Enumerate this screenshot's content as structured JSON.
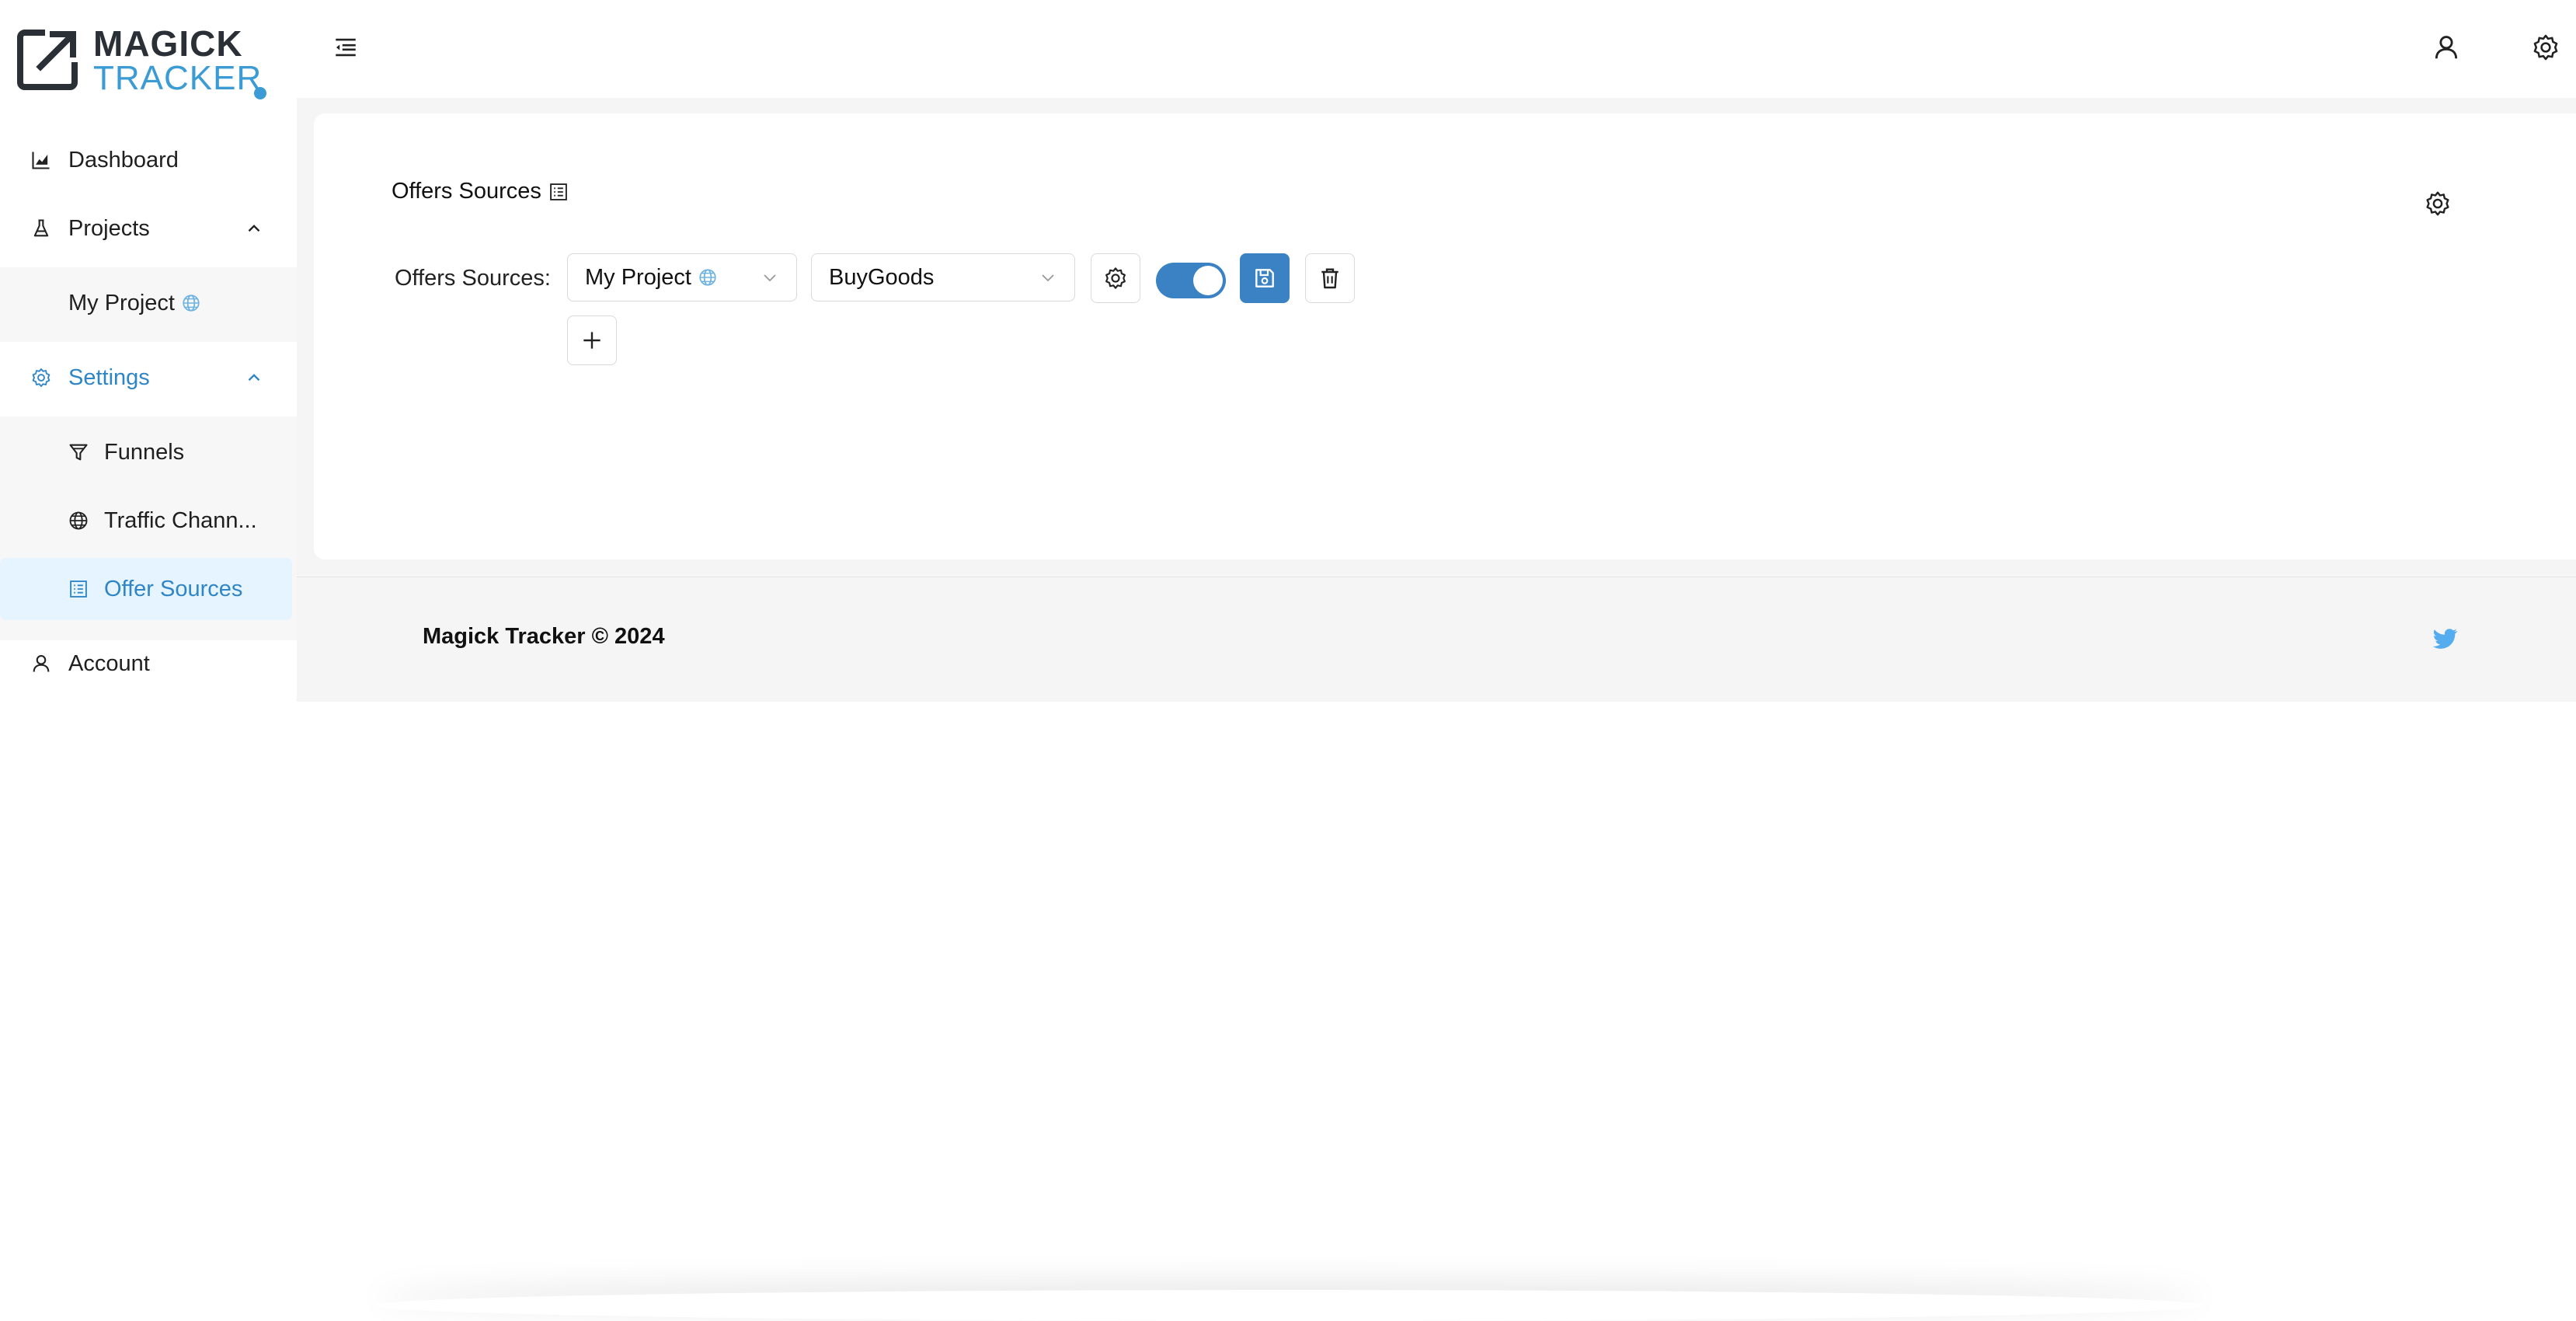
{
  "brand": {
    "line1": "MAGICK",
    "line2": "TRACKER",
    "accent_color": "#3a9bd5"
  },
  "sidebar": {
    "items": [
      {
        "label": "Dashboard",
        "icon": "chart-area-icon"
      },
      {
        "label": "Projects",
        "icon": "flask-icon",
        "expanded": true
      },
      {
        "label": "My Project",
        "icon": "globe-icon",
        "sub": true
      },
      {
        "label": "Settings",
        "icon": "gear-icon",
        "expanded": true,
        "active": true
      },
      {
        "label": "Funnels",
        "icon": "funnel-icon",
        "sub": true
      },
      {
        "label": "Traffic Chann...",
        "icon": "globe-icon",
        "sub": true
      },
      {
        "label": "Offer Sources",
        "icon": "list-icon",
        "sub": true,
        "selected": true
      },
      {
        "label": "Account",
        "icon": "user-icon"
      }
    ]
  },
  "main": {
    "title": "Offers Sources",
    "form": {
      "label": "Offers Sources",
      "project_value": "My Project",
      "source_value": "BuyGoods",
      "enabled": true
    }
  },
  "footer": {
    "text": "Magick Tracker © 2024"
  },
  "colors": {
    "primary": "#3a82c4",
    "link": "#2f86c7",
    "selected_bg": "#e6f4ff"
  }
}
